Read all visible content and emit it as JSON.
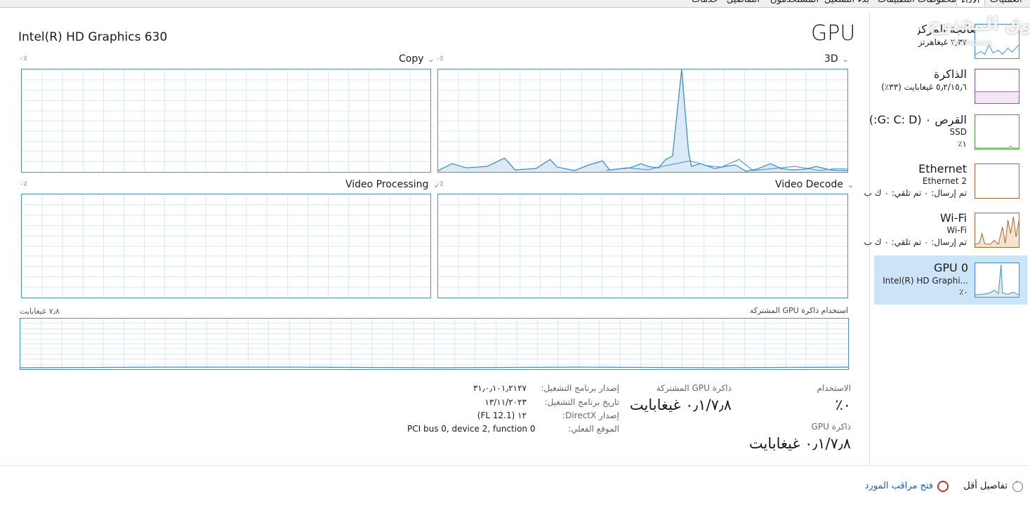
{
  "tabs": [
    {
      "label": "خدمات"
    },
    {
      "label": "التفاصيل"
    },
    {
      "label": "المستخدمون"
    },
    {
      "label": "بدء التشغيل"
    },
    {
      "label": "محفوظات التطبيقات"
    },
    {
      "label": "الأداء",
      "active": true
    },
    {
      "label": "العمليات"
    }
  ],
  "header": {
    "gpu_name": "Intel(R) HD Graphics 630",
    "title": "GPU"
  },
  "panels": {
    "copy": {
      "label": "Copy",
      "percent": "٠٪",
      "line_color": "#3f8fc4"
    },
    "three_d": {
      "label": "3D",
      "percent": "٠٪",
      "line_color": "#3f8fc4"
    },
    "video_processing": {
      "label": "Video Processing",
      "percent": "٠٪"
    },
    "video_decode": {
      "label": "Video Decode",
      "percent": "٠٪"
    },
    "shared_memory": {
      "label": "استخدام ذاكرة GPU المشتركة",
      "max": "٧٫٨ غيغابايت"
    }
  },
  "stats": {
    "utilization": {
      "label": "الاستخدام",
      "value": "٠٪"
    },
    "shared_gpu_memory": {
      "label": "ذاكرة GPU المشتركة",
      "value": "٠٫١/٧٫٨ غيغابايت"
    },
    "gpu_memory": {
      "label": "ذاكرة GPU",
      "value": "٠٫١/٧٫٨ غيغابايت"
    }
  },
  "driver": {
    "version_key": "إصدار برنامج التشغيل:",
    "version_value": "٣١٫٠٫١٠١٫٢١٢٧",
    "date_key": "تاريخ برنامج التشغيل:",
    "date_value": "١٣/١١/٢٠٢٣",
    "directx_key": "إصدار DirectX:",
    "directx_value": "١٢ (FL 12.1)",
    "location_key": "الموقع الفعلي:",
    "location_value": "PCI bus 0, device 2, function 0"
  },
  "sidebar": {
    "cpu": {
      "title": "وحدة المعالجة المركزية",
      "sub": "٢٫٣٧ غيغاهرتز"
    },
    "memory": {
      "title": "الذاكرة",
      "sub": "٥٫٢/١٥٫٦ غيغابايت (٣٣٪)",
      "color": "#9b4fa8"
    },
    "disk": {
      "title": "القرص ٠ (G: C: D:)",
      "sub1": "SSD",
      "sub2": "١٪",
      "color": "#4aa63b"
    },
    "ethernet": {
      "title": "Ethernet",
      "sub1": "Ethernet 2",
      "sub2": "تم إرسال: ٠ تم تلقي: ٠ ك ب",
      "color": "#a9672b"
    },
    "wifi": {
      "title": "Wi-Fi",
      "sub1": "Wi-Fi",
      "sub2": "تم إرسال: ٠ تم تلقي: ٠ ك ب",
      "color": "#a9672b"
    },
    "gpu": {
      "title": "GPU 0",
      "sub1": "Intel(R) HD Graphi...",
      "sub2": "٠٪",
      "color": "#3f8fc4"
    }
  },
  "footer": {
    "fewer_details": "تفاصيل أقل",
    "open_resource_monitor": "فتح مراقب المورد"
  },
  "watermark": {
    "text": "السوق المفتوح",
    "sub": "opensooq"
  },
  "colors": {
    "accent": "#3f8fc4",
    "selected_bg": "#cce4f7"
  }
}
